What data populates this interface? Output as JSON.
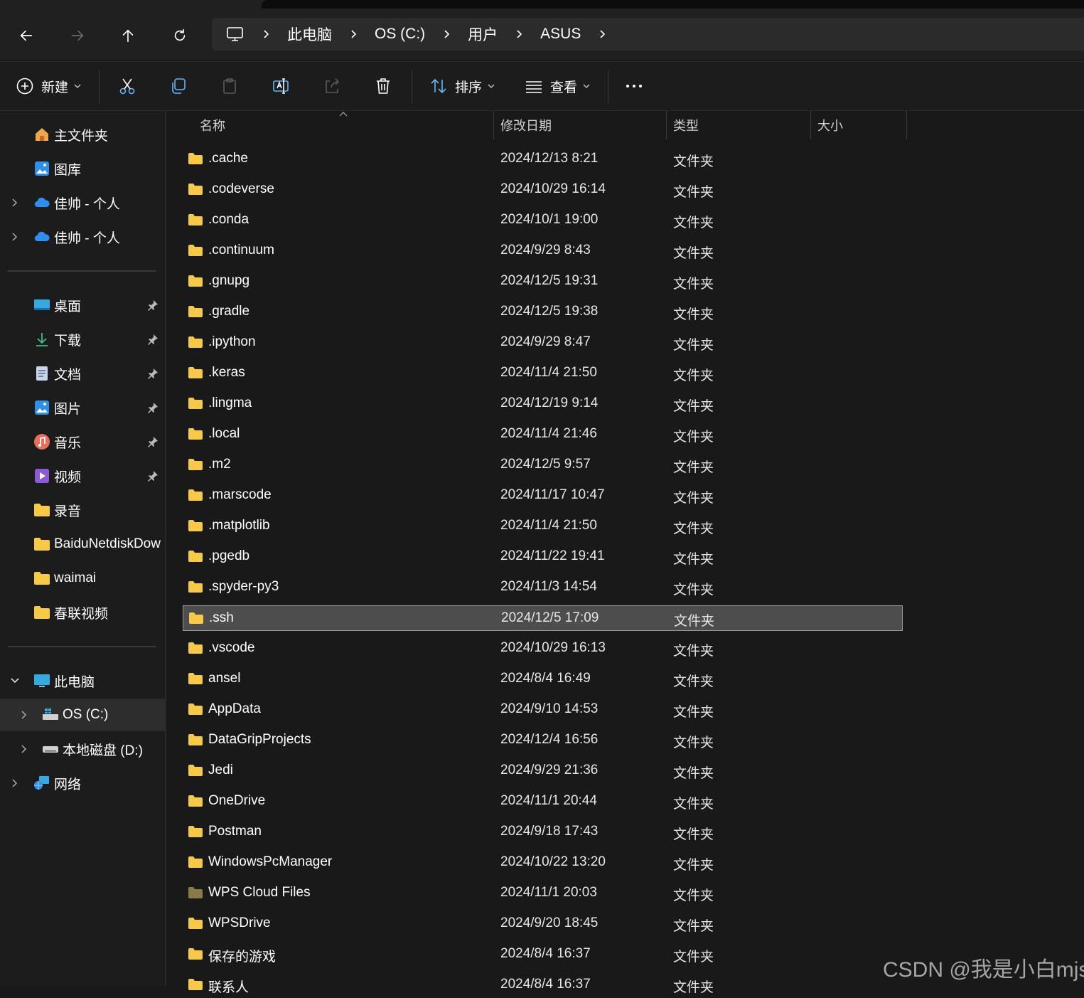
{
  "breadcrumb": [
    "此电脑",
    "OS (C:)",
    "用户",
    "ASUS"
  ],
  "toolbar": {
    "new_label": "新建",
    "sort_label": "排序",
    "view_label": "查看"
  },
  "sidebar": {
    "quick": [
      {
        "label": "主文件夹",
        "icon": "home-icon"
      },
      {
        "label": "图库",
        "icon": "gallery-icon"
      },
      {
        "label": "佳帅 - 个人",
        "icon": "onedrive-cloud-icon"
      },
      {
        "label": "佳帅 - 个人",
        "icon": "onedrive-cloud-icon"
      }
    ],
    "pinned": [
      {
        "label": "桌面",
        "icon": "desktop-icon"
      },
      {
        "label": "下载",
        "icon": "download-icon"
      },
      {
        "label": "文档",
        "icon": "document-icon"
      },
      {
        "label": "图片",
        "icon": "pictures-icon"
      },
      {
        "label": "音乐",
        "icon": "music-icon"
      },
      {
        "label": "视频",
        "icon": "video-icon"
      },
      {
        "label": "录音",
        "icon": "folder-icon"
      },
      {
        "label": "BaiduNetdiskDow",
        "icon": "folder-icon"
      },
      {
        "label": "waimai",
        "icon": "folder-icon"
      },
      {
        "label": "春联视频",
        "icon": "folder-icon"
      }
    ],
    "devices": [
      {
        "label": "此电脑",
        "icon": "this-pc-icon"
      },
      {
        "label": "OS (C:)",
        "icon": "windows-drive-icon"
      },
      {
        "label": "本地磁盘 (D:)",
        "icon": "drive-icon"
      },
      {
        "label": "网络",
        "icon": "network-icon"
      }
    ]
  },
  "columns": {
    "name": "名称",
    "date": "修改日期",
    "type": "类型",
    "size": "大小"
  },
  "files": [
    {
      "name": ".cache",
      "date": "2024/12/13 8:21",
      "type": "文件夹"
    },
    {
      "name": ".codeverse",
      "date": "2024/10/29 16:14",
      "type": "文件夹"
    },
    {
      "name": ".conda",
      "date": "2024/10/1 19:00",
      "type": "文件夹"
    },
    {
      "name": ".continuum",
      "date": "2024/9/29 8:43",
      "type": "文件夹"
    },
    {
      "name": ".gnupg",
      "date": "2024/12/5 19:31",
      "type": "文件夹"
    },
    {
      "name": ".gradle",
      "date": "2024/12/5 19:38",
      "type": "文件夹"
    },
    {
      "name": ".ipython",
      "date": "2024/9/29 8:47",
      "type": "文件夹"
    },
    {
      "name": ".keras",
      "date": "2024/11/4 21:50",
      "type": "文件夹"
    },
    {
      "name": ".lingma",
      "date": "2024/12/19 9:14",
      "type": "文件夹"
    },
    {
      "name": ".local",
      "date": "2024/11/4 21:46",
      "type": "文件夹"
    },
    {
      "name": ".m2",
      "date": "2024/12/5 9:57",
      "type": "文件夹"
    },
    {
      "name": ".marscode",
      "date": "2024/11/17 10:47",
      "type": "文件夹"
    },
    {
      "name": ".matplotlib",
      "date": "2024/11/4 21:50",
      "type": "文件夹"
    },
    {
      "name": ".pgedb",
      "date": "2024/11/22 19:41",
      "type": "文件夹"
    },
    {
      "name": ".spyder-py3",
      "date": "2024/11/3 14:54",
      "type": "文件夹"
    },
    {
      "name": ".ssh",
      "date": "2024/12/5 17:09",
      "type": "文件夹",
      "selected": true
    },
    {
      "name": ".vscode",
      "date": "2024/10/29 16:13",
      "type": "文件夹"
    },
    {
      "name": "ansel",
      "date": "2024/8/4 16:49",
      "type": "文件夹"
    },
    {
      "name": "AppData",
      "date": "2024/9/10 14:53",
      "type": "文件夹"
    },
    {
      "name": "DataGripProjects",
      "date": "2024/12/4 16:56",
      "type": "文件夹"
    },
    {
      "name": "Jedi",
      "date": "2024/9/29 21:36",
      "type": "文件夹"
    },
    {
      "name": "OneDrive",
      "date": "2024/11/1 20:44",
      "type": "文件夹"
    },
    {
      "name": "Postman",
      "date": "2024/9/18 17:43",
      "type": "文件夹"
    },
    {
      "name": "WindowsPcManager",
      "date": "2024/10/22 13:20",
      "type": "文件夹"
    },
    {
      "name": "WPS Cloud Files",
      "date": "2024/11/1 20:03",
      "type": "文件夹",
      "dim": true
    },
    {
      "name": "WPSDrive",
      "date": "2024/9/20 18:45",
      "type": "文件夹"
    },
    {
      "name": "保存的游戏",
      "date": "2024/8/4 16:37",
      "type": "文件夹"
    },
    {
      "name": "联系人",
      "date": "2024/8/4 16:37",
      "type": "文件夹"
    }
  ],
  "watermark": "CSDN @我是小白mjs",
  "colors": {
    "folder": "#f7c948",
    "folder_dim": "#8a7a4a",
    "accent": "#4cc2ff"
  }
}
